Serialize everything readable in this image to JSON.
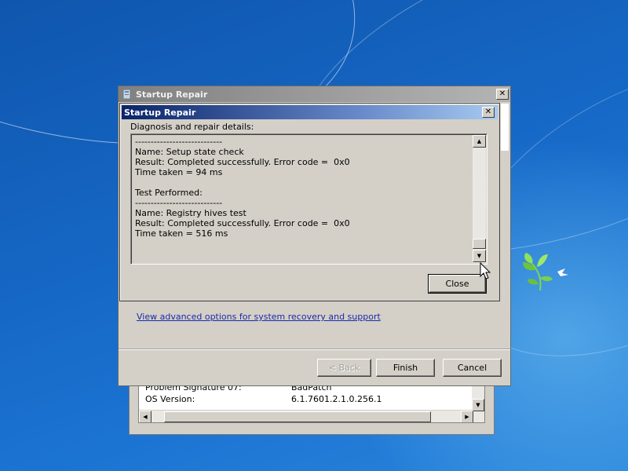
{
  "background_window": {
    "rows": [
      {
        "label": "Problem Signature 07:",
        "value": "BadPatch"
      },
      {
        "label": "OS Version:",
        "value": "6.1.7601.2.1.0.256.1"
      }
    ]
  },
  "main_window": {
    "title": "Startup Repair",
    "advanced_link": "View advanced options for system recovery and support",
    "buttons": {
      "back": "< Back",
      "finish": "Finish",
      "cancel": "Cancel"
    }
  },
  "dialog": {
    "title": "Startup Repair",
    "details_label": "Diagnosis and repair details:",
    "details_lines": [
      "----------------------------",
      "Name: Setup state check",
      "Result: Completed successfully. Error code =  0x0",
      "Time taken = 94 ms",
      "",
      "Test Performed:",
      "----------------------------",
      "Name: Registry hives test",
      "Result: Completed successfully. Error code =  0x0",
      "Time taken = 516 ms"
    ],
    "close_button": "Close"
  },
  "colors": {
    "desktop": "#1668c6",
    "dialog_title_active": "#0a246a",
    "window_face": "#d4d0c8",
    "link": "#1a2aa8"
  }
}
